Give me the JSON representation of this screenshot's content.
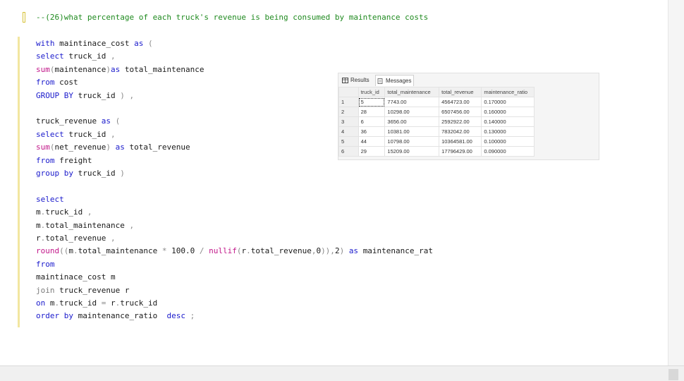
{
  "editor": {
    "comment": "--(26)what percentage of each truck's revenue is being consumed by maintenance costs",
    "lines": [
      [
        [
          "kw",
          "with "
        ],
        [
          "id",
          "maintinace_cost "
        ],
        [
          "kw",
          "as "
        ],
        [
          "op",
          "("
        ]
      ],
      [
        [
          "kw",
          "select "
        ],
        [
          "id",
          "truck_id "
        ],
        [
          "op",
          ","
        ]
      ],
      [
        [
          "fn",
          "sum"
        ],
        [
          "op",
          "("
        ],
        [
          "id",
          "maintenance"
        ],
        [
          "op",
          ")"
        ],
        [
          "kw",
          "as "
        ],
        [
          "id",
          "total_maintenance"
        ]
      ],
      [
        [
          "kw",
          "from "
        ],
        [
          "id",
          "cost"
        ]
      ],
      [
        [
          "kw",
          "GROUP BY "
        ],
        [
          "id",
          "truck_id "
        ],
        [
          "op",
          ") ,"
        ]
      ],
      [],
      [
        [
          "id",
          "truck_revenue "
        ],
        [
          "kw",
          "as "
        ],
        [
          "op",
          "("
        ]
      ],
      [
        [
          "kw",
          "select "
        ],
        [
          "id",
          "truck_id "
        ],
        [
          "op",
          ","
        ]
      ],
      [
        [
          "fn",
          "sum"
        ],
        [
          "op",
          "("
        ],
        [
          "id",
          "net_revenue"
        ],
        [
          "op",
          ") "
        ],
        [
          "kw",
          "as "
        ],
        [
          "id",
          "total_revenue"
        ]
      ],
      [
        [
          "kw",
          "from "
        ],
        [
          "id",
          "freight"
        ]
      ],
      [
        [
          "kw",
          "group by "
        ],
        [
          "id",
          "truck_id "
        ],
        [
          "op",
          ")"
        ]
      ],
      [],
      [
        [
          "kw",
          "select"
        ]
      ],
      [
        [
          "id",
          "m"
        ],
        [
          "op",
          "."
        ],
        [
          "id",
          "truck_id "
        ],
        [
          "op",
          ","
        ]
      ],
      [
        [
          "id",
          "m"
        ],
        [
          "op",
          "."
        ],
        [
          "id",
          "total_maintenance "
        ],
        [
          "op",
          ","
        ]
      ],
      [
        [
          "id",
          "r"
        ],
        [
          "op",
          "."
        ],
        [
          "id",
          "total_revenue "
        ],
        [
          "op",
          ","
        ]
      ],
      [
        [
          "fn",
          "round"
        ],
        [
          "op",
          "(("
        ],
        [
          "id",
          "m"
        ],
        [
          "op",
          "."
        ],
        [
          "id",
          "total_maintenance "
        ],
        [
          "op",
          "* "
        ],
        [
          "id",
          "100.0 "
        ],
        [
          "op",
          "/ "
        ],
        [
          "fn",
          "nullif"
        ],
        [
          "op",
          "("
        ],
        [
          "id",
          "r"
        ],
        [
          "op",
          "."
        ],
        [
          "id",
          "total_revenue"
        ],
        [
          "op",
          ","
        ],
        [
          "id",
          "0"
        ],
        [
          "op",
          ")),"
        ],
        [
          "id",
          "2"
        ],
        [
          "op",
          ") "
        ],
        [
          "kw",
          "as "
        ],
        [
          "id",
          "maintenance_rat"
        ]
      ],
      [
        [
          "kw",
          "from"
        ]
      ],
      [
        [
          "id",
          "maintinace_cost m"
        ]
      ],
      [
        [
          "jn",
          "join "
        ],
        [
          "id",
          "truck_revenue r"
        ]
      ],
      [
        [
          "kw",
          "on "
        ],
        [
          "id",
          "m"
        ],
        [
          "op",
          "."
        ],
        [
          "id",
          "truck_id "
        ],
        [
          "op",
          "= "
        ],
        [
          "id",
          "r"
        ],
        [
          "op",
          "."
        ],
        [
          "id",
          "truck_id"
        ]
      ],
      [
        [
          "kw",
          "order by "
        ],
        [
          "id",
          "maintenance_ratio  "
        ],
        [
          "kw",
          "desc "
        ],
        [
          "op",
          ";"
        ]
      ]
    ]
  },
  "results": {
    "tabs": {
      "results": "Results",
      "messages": "Messages"
    },
    "columns": [
      "truck_id",
      "total_maintenance",
      "total_revenue",
      "maintenance_ratio"
    ],
    "rows": [
      [
        "1",
        "5",
        "7743.00",
        "4564723.00",
        "0.170000"
      ],
      [
        "2",
        "28",
        "10298.00",
        "6507456.00",
        "0.160000"
      ],
      [
        "3",
        "6",
        "3656.00",
        "2592922.00",
        "0.140000"
      ],
      [
        "4",
        "36",
        "10381.00",
        "7832042.00",
        "0.130000"
      ],
      [
        "5",
        "44",
        "10798.00",
        "10364581.00",
        "0.100000"
      ],
      [
        "6",
        "29",
        "15209.00",
        "17796429.00",
        "0.090000"
      ]
    ]
  }
}
